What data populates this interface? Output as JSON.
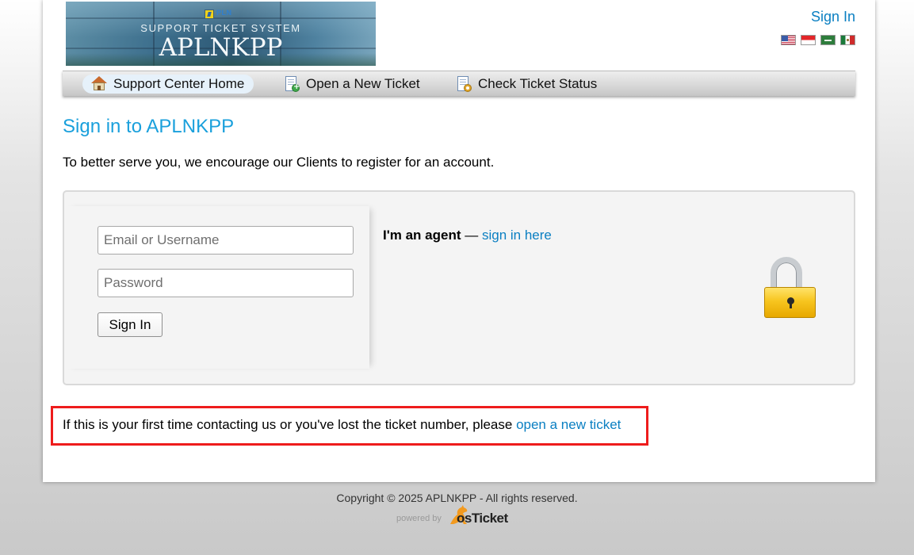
{
  "header": {
    "logo": {
      "brand": "PLN",
      "subtitle": "SUPPORT TICKET SYSTEM",
      "title": "APLNKPP"
    },
    "signin_label": "Sign In",
    "languages": [
      {
        "name": "English (US)"
      },
      {
        "name": "Indonesian"
      },
      {
        "name": "Arabic"
      },
      {
        "name": "Spanish (Mexico)"
      }
    ]
  },
  "nav": {
    "items": [
      {
        "label": "Support Center Home",
        "icon": "home-icon",
        "active": true
      },
      {
        "label": "Open a New Ticket",
        "icon": "new-ticket-icon",
        "active": false
      },
      {
        "label": "Check Ticket Status",
        "icon": "ticket-status-icon",
        "active": false
      }
    ]
  },
  "main": {
    "title": "Sign in to APLNKPP",
    "intro": "To better serve you, we encourage our Clients to register for an account.",
    "form": {
      "email_placeholder": "Email or Username",
      "email_value": "",
      "password_placeholder": "Password",
      "password_value": "",
      "submit_label": "Sign In"
    },
    "agent": {
      "label": "I'm an agent",
      "separator": " — ",
      "link_label": "sign in here"
    },
    "notice": {
      "text": "If this is your first time contacting us or you've lost the ticket number, please ",
      "link_label": "open a new ticket"
    }
  },
  "footer": {
    "copyright": "Copyright © 2025 APLNKPP - All rights reserved.",
    "powered_by": "powered by",
    "product_prefix": "os",
    "product_name": "Ticket"
  },
  "colors": {
    "link": "#0a7fc2",
    "heading": "#1aa0dc",
    "notice_border": "#ee1c1c"
  }
}
